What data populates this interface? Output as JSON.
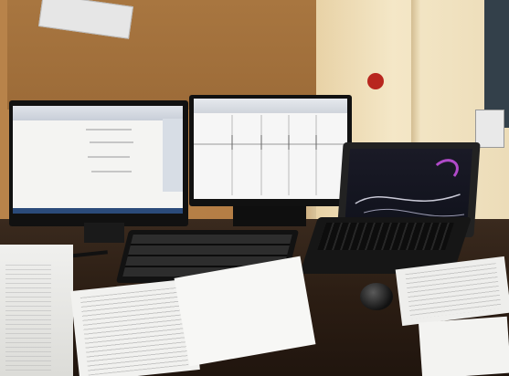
{
  "scene": {
    "description_tag": "",
    "colors": {
      "corkboard": "#a87640",
      "wall": "#efe0bd",
      "desk": "#2b1d13",
      "screen": "#f4f4f2",
      "laptop_screen": "#10121c",
      "paper": "#f1f1ef"
    }
  }
}
